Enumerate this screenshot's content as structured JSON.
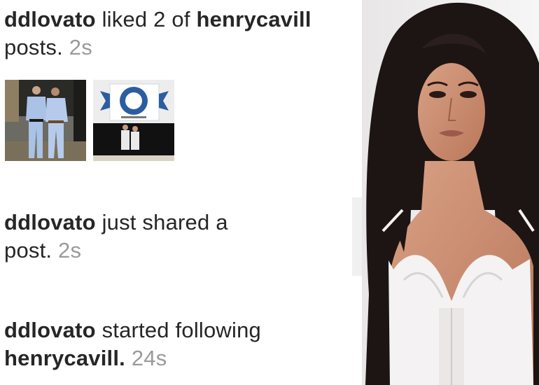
{
  "activities": [
    {
      "user": "ddlovato",
      "text": " liked 2 of ",
      "target": "henrycavill",
      "line2": "posts.",
      "time": "2s"
    },
    {
      "user": "ddlovato",
      "text": " just shared a",
      "line2": "post.",
      "time": "2s"
    },
    {
      "user": "ddlovato",
      "text": " started following",
      "target": "henrycavill.",
      "time": "24s"
    }
  ],
  "thumbnails": [
    {
      "name": "two-men-in-gis-photo"
    },
    {
      "name": "gym-banner-photo"
    }
  ],
  "photo": {
    "name": "portrait-photo"
  },
  "colors": {
    "text": "#262626",
    "timestamp": "#9a9a9a",
    "background": "#ffffff"
  }
}
